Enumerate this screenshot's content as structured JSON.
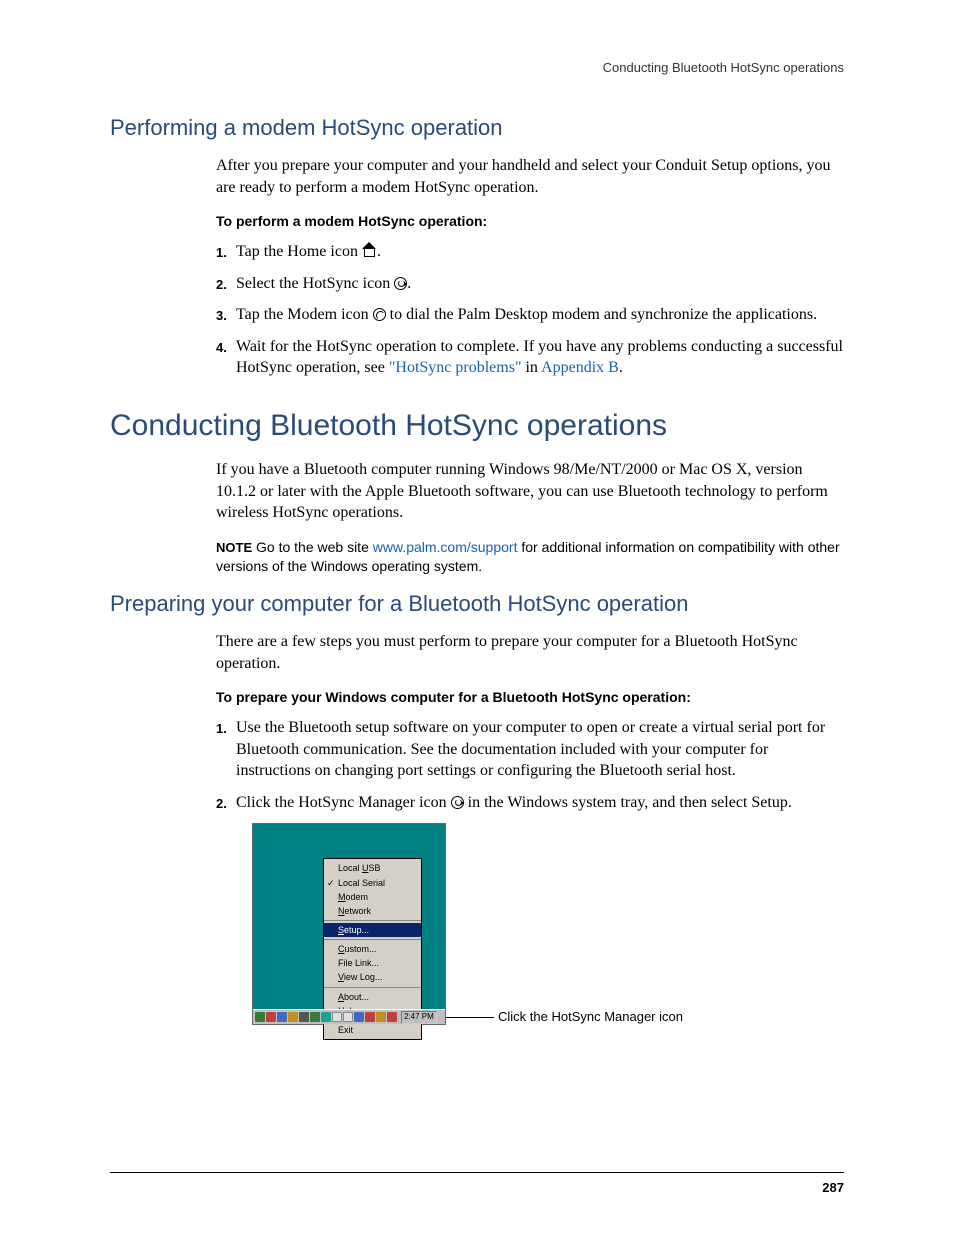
{
  "running_head": "Conducting Bluetooth HotSync operations",
  "h2_a": "Performing a modem HotSync operation",
  "intro_a": "After you prepare your computer and your handheld and select your Conduit Setup options, you are ready to perform a modem HotSync operation.",
  "h3_a": "To perform a modem HotSync operation:",
  "steps_a": [
    "Tap the Home icon ",
    "Select the HotSync icon ",
    "Tap the Modem icon ",
    "Wait for the HotSync operation to complete. If you have any problems conducting a successful HotSync operation, see "
  ],
  "step3_tail": " to dial the Palm Desktop modem and synchronize the applications.",
  "link_hotsync_problems": "\"HotSync problems\"",
  "step4_in": " in ",
  "link_appendix": "Appendix B",
  "period": ".",
  "h1_b": "Conducting Bluetooth HotSync operations",
  "intro_b": "If you have a Bluetooth computer running Windows 98/Me/NT/2000 or Mac OS X, version 10.1.2 or later with the Apple Bluetooth software, you can use Bluetooth technology to perform wireless HotSync operations.",
  "note_label": "NOTE",
  "note_pre": "  Go to the web site ",
  "note_link": "www.palm.com/support",
  "note_post": " for additional information on compatibility with other versions of the Windows operating system.",
  "h2_b": "Preparing your computer for a Bluetooth HotSync operation",
  "intro_c": "There are a few steps you must perform to prepare your computer for a Bluetooth HotSync operation.",
  "h3_b": "To prepare your Windows computer for a Bluetooth HotSync operation:",
  "steps_b": [
    "Use the Bluetooth setup software on your computer to open or create a virtual serial port for Bluetooth communication. See the documentation included with your computer for instructions on changing port settings or configuring the Bluetooth serial host.",
    "Click the HotSync Manager icon "
  ],
  "step_b2_tail": " in the Windows system tray, and then select Setup.",
  "menu": {
    "group1": [
      {
        "ul": "U",
        "label": "Local USB",
        "checked": false
      },
      {
        "ul": "",
        "label": "Local Serial",
        "checked": true
      },
      {
        "ul": "M",
        "label": "odem",
        "checked": false
      },
      {
        "ul": "N",
        "label": "etwork",
        "checked": false
      }
    ],
    "group2": [
      {
        "ul": "S",
        "label": "etup...",
        "selected": true
      }
    ],
    "group3": [
      {
        "ul": "C",
        "label": "ustom..."
      },
      {
        "ul": "",
        "label": "File Link..."
      },
      {
        "ul": "V",
        "label": "iew Log..."
      }
    ],
    "group4": [
      {
        "ul": "A",
        "label": "bout..."
      },
      {
        "ul": "H",
        "label": "elp..."
      }
    ],
    "group5": [
      {
        "ul": "",
        "label": "Exit"
      }
    ]
  },
  "clock": "2:47 PM",
  "fig_caption": "Click the HotSync Manager icon",
  "page_number": "287"
}
